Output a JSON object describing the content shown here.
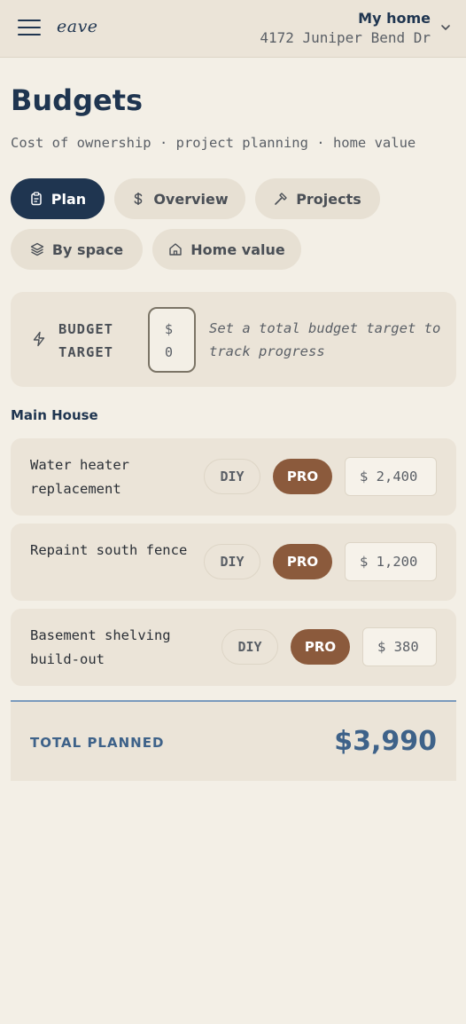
{
  "header": {
    "logo": "eave",
    "home_title": "My home",
    "home_address": "4172 Juniper Bend Dr"
  },
  "page": {
    "title": "Budgets",
    "subtitle": "Cost of ownership · project planning · home value"
  },
  "tabs": [
    {
      "label": "Plan",
      "icon": "clipboard-icon",
      "active": true
    },
    {
      "label": "Overview",
      "icon": "dollar-icon",
      "active": false
    },
    {
      "label": "Projects",
      "icon": "hammer-icon",
      "active": false
    },
    {
      "label": "By space",
      "icon": "layers-icon",
      "active": false
    },
    {
      "label": "Home value",
      "icon": "house-icon",
      "active": false
    }
  ],
  "budget_target": {
    "label": "BUDGET TARGET",
    "currency": "$",
    "value": "0",
    "hint": "Set a total budget target to track progress"
  },
  "section": {
    "label": "Main House"
  },
  "items": [
    {
      "name": "Water heater replacement",
      "diy_label": "DIY",
      "pro_label": "PRO",
      "selected": "PRO",
      "cost": "$ 2,400"
    },
    {
      "name": "Repaint south fence",
      "diy_label": "DIY",
      "pro_label": "PRO",
      "selected": "PRO",
      "cost": "$ 1,200"
    },
    {
      "name": "Basement shelving build-out",
      "diy_label": "DIY",
      "pro_label": "PRO",
      "selected": "PRO",
      "cost": "$ 380"
    }
  ],
  "total": {
    "label": "TOTAL PLANNED",
    "value": "$3,990"
  },
  "colors": {
    "background": "#f3efe6",
    "card": "#ebe4d8",
    "navy": "#1f3550",
    "pro_brown": "#8b5a3c",
    "total_blue": "#3e6289"
  }
}
